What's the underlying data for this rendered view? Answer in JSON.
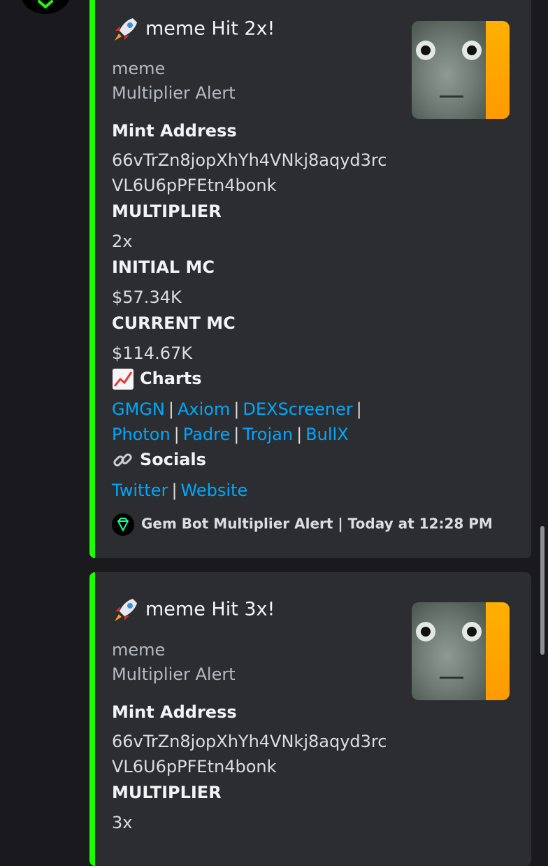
{
  "embeds": [
    {
      "title": "meme Hit 2x!",
      "desc_line1": "meme",
      "desc_line2": "Multiplier Alert",
      "mint_label": "Mint Address",
      "mint_line1": "66vTrZn8jopXhYh4VNkj8aqyd3rc",
      "mint_line2": "VL6U6pPFEtn4bonk",
      "multiplier_label": "MULTIPLIER",
      "multiplier_value": "2x",
      "initial_label": "INITIAL MC",
      "initial_value": "$57.34K",
      "current_label": "CURRENT MC",
      "current_value": "$114.67K",
      "charts_label": "Charts",
      "chart_links": [
        "GMGN",
        "Axiom",
        "DEXScreener",
        "Photon",
        "Padre",
        "Trojan",
        "BullX"
      ],
      "socials_label": "Socials",
      "social_links": [
        "Twitter",
        "Website"
      ],
      "footer_text": "Gem Bot Multiplier Alert | Today at 12:28 PM"
    },
    {
      "title": "meme Hit 3x!",
      "desc_line1": "meme",
      "desc_line2": "Multiplier Alert",
      "mint_label": "Mint Address",
      "mint_line1": "66vTrZn8jopXhYh4VNkj8aqyd3rc",
      "mint_line2": "VL6U6pPFEtn4bonk",
      "multiplier_label": "MULTIPLIER",
      "multiplier_value": "3x"
    }
  ],
  "icons": {
    "title_icon": "rocket-icon",
    "charts_icon": "chart-increasing-icon",
    "socials_icon": "link-icon",
    "footer_icon": "gem-icon"
  },
  "colors": {
    "accent_bar": "#1dfc00",
    "link": "#00a8fc",
    "embed_bg": "#2b2d31"
  }
}
